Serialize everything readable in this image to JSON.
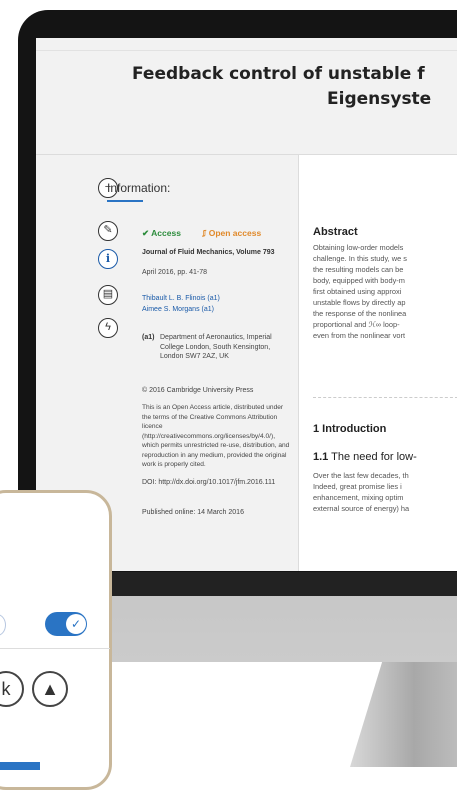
{
  "article": {
    "title_line1": "Feedback control of unstable f",
    "title_line2": "Eigensyste"
  },
  "sidebar": {
    "info_label": "Information:",
    "icons": [
      "minus-icon",
      "feather-icon",
      "info-icon",
      "chart-icon",
      "lightning-icon"
    ],
    "access": "✔ Access",
    "open_access": "Open access",
    "journal": "Journal of Fluid Mechanics, Volume 793",
    "date_pages": "April 2016, pp. 41-78",
    "author1": "Thibault L. B. Flinois",
    "author1_aff": "(a1)",
    "author2": "Aimee S. Morgans",
    "author2_aff": "(a1)",
    "affiliation_tag": "(a1)",
    "affiliation": "Department of Aeronautics, Imperial College London, South Kensington, London SW7 2AZ, UK",
    "copyright": "© 2016 Cambridge University Press",
    "license": "This is an Open Access article, distributed under the terms of the Creative Commons Attribution licence (http://creativecommons.org/licenses/by/4.0/), which permits unrestricted re-use, distribution, and reproduction in any medium, provided the original work is properly cited.",
    "doi": "DOI: http://dx.doi.org/10.1017/jfm.2016.111",
    "published": "Published online: 14 March 2016"
  },
  "main": {
    "abstract_heading": "Abstract",
    "abstract_lines": [
      "Obtaining low-order models",
      "challenge. In this study, we s",
      "the resulting models can be",
      "body, equipped with body-m",
      "first obtained using approxi",
      "unstable flows by directly ap",
      "the response of the nonlinea",
      "proportional and ℋ∞ loop-",
      "even from the nonlinear vort"
    ],
    "intro_heading": "1 Introduction",
    "subsection_number": "1.1",
    "subsection_title": "The need for low-",
    "intro_lines": [
      "Over the last few decades, th",
      "Indeed, great promise lies i",
      "enhancement, mixing optim",
      "external source of energy) ha"
    ]
  },
  "overlay_panel": {
    "toggle_check": "✓",
    "share_icons": [
      "k",
      "▲"
    ]
  },
  "colors": {
    "access_green": "#2c8c3c",
    "open_access_orange": "#e0892a",
    "link_blue": "#1a5aa8",
    "toggle_blue": "#2a74c4",
    "panel_border": "#c8b79a"
  }
}
